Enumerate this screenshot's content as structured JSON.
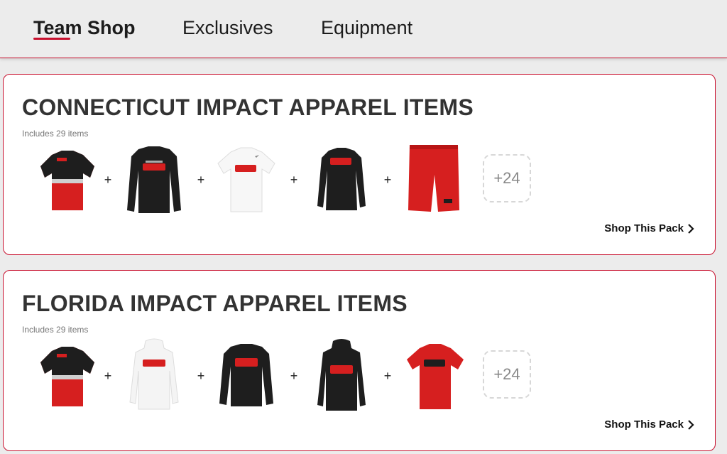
{
  "nav": {
    "tabs": [
      {
        "label": "Team Shop",
        "active": true
      },
      {
        "label": "Exclusives",
        "active": false
      },
      {
        "label": "Equipment",
        "active": false
      }
    ]
  },
  "colors": {
    "accent": "#c8102e",
    "dark_garment": "#1e1e1e",
    "red_garment": "#d61f1f"
  },
  "packs": [
    {
      "title": "CONNECTICUT IMPACT APPAREL ITEMS",
      "subtitle": "Includes 29 items",
      "items": [
        "red-black-colorblock-tee",
        "black-long-sleeve-tee",
        "white-tee",
        "black-long-sleeve-womens",
        "red-shorts"
      ],
      "more": "+24",
      "link": "Shop This Pack"
    },
    {
      "title": "FLORIDA IMPACT APPAREL ITEMS",
      "subtitle": "Includes 29 items",
      "items": [
        "red-black-colorblock-tee",
        "white-hoodie",
        "black-crewneck",
        "black-hoodie",
        "red-tee"
      ],
      "more": "+24",
      "link": "Shop This Pack"
    }
  ]
}
